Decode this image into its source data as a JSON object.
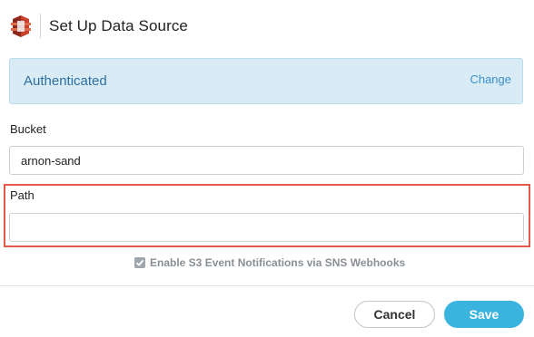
{
  "header": {
    "title": "Set Up Data Source",
    "logo_icon": "aws-s3-icon"
  },
  "auth": {
    "status_text": "Authenticated",
    "change_label": "Change"
  },
  "form": {
    "bucket_label": "Bucket",
    "bucket_value": "arnon-sand",
    "path_label": "Path",
    "path_value": "",
    "sns_checkbox_label": "Enable S3 Event Notifications via SNS Webhooks",
    "sns_checked": true
  },
  "footer": {
    "cancel_label": "Cancel",
    "save_label": "Save"
  },
  "colors": {
    "accent": "#3ab4de",
    "banner_bg": "#d9ecf6",
    "banner_text": "#2c6ea0",
    "highlight": "#e35a4b",
    "logo_red": "#c7412d"
  }
}
